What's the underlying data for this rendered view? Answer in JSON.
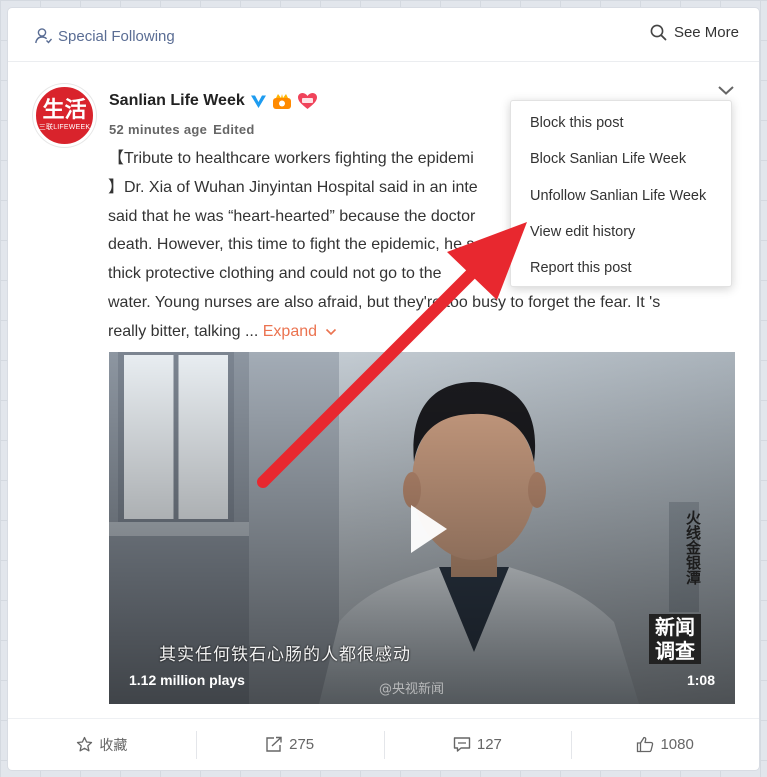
{
  "topbar": {
    "special_following": "Special Following",
    "see_more": "See More"
  },
  "post": {
    "avatar": {
      "big": "生活",
      "small": "三联LIFEWEEK"
    },
    "author": "Sanlian Life Week",
    "time": "52 minutes age",
    "edited": "Edited",
    "text_lines": [
      "【Tribute to healthcare workers fighting the epidemi",
      "】Dr. Xia of Wuhan Jinyintan Hospital said in an inte",
      "said that he was “heart-hearted” because the doctor",
      "death. However, this time to fight the epidemic, he s",
      "thick protective clothing and could not go to the",
      "water. Young nurses are also afraid, but they're too busy to forget the fear. It 's",
      "really bitter, talking ..."
    ],
    "expand_label": "Expand"
  },
  "video": {
    "subtitle": "其实任何铁石心肠的人都很感动",
    "plays": "1.12 million plays",
    "duration": "1:08",
    "watermark": "@央视新闻",
    "side_caption": "火线金银潭",
    "logo_top": "新闻",
    "logo_bottom": "调查"
  },
  "actions": {
    "favorite": "收藏",
    "repost": "275",
    "comment": "127",
    "like": "1080"
  },
  "menu": {
    "items": [
      "Block this post",
      "Block Sanlian Life Week",
      "Unfollow Sanlian Life Week",
      "View edit history",
      "Report this post"
    ]
  },
  "colors": {
    "accent_link": "#5a6d94",
    "expand": "#eb7350",
    "annotation_arrow": "#e8282f",
    "brand_red": "#d9232c"
  }
}
